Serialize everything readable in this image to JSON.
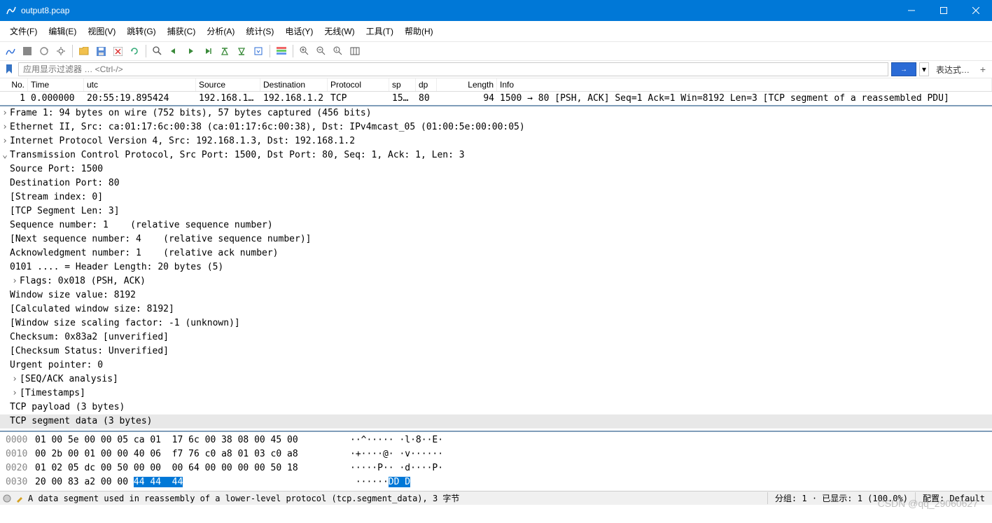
{
  "window": {
    "title": "output8.pcap"
  },
  "menu": {
    "file": "文件(F)",
    "edit": "编辑(E)",
    "view": "视图(V)",
    "go": "跳转(G)",
    "capture": "捕获(C)",
    "analyze": "分析(A)",
    "stats": "统计(S)",
    "telephony": "电话(Y)",
    "wireless": "无线(W)",
    "tools": "工具(T)",
    "help": "帮助(H)"
  },
  "filter": {
    "placeholder": "应用显示过滤器 … <Ctrl-/>",
    "expr_label": "表达式…"
  },
  "columns": {
    "no": "No.",
    "time": "Time",
    "utc": "utc",
    "src": "Source",
    "dst": "Destination",
    "proto": "Protocol",
    "sp": "sp",
    "dp": "dp",
    "len": "Length",
    "info": "Info"
  },
  "packet": {
    "no": "1",
    "time": "0.000000",
    "utc": "20:55:19.895424",
    "src": "192.168.1…",
    "dst": "192.168.1.2",
    "proto": "TCP",
    "sp": "15…",
    "dp": "80",
    "len": "94",
    "info": "1500 → 80 [PSH, ACK] Seq=1 Ack=1 Win=8192 Len=3 [TCP segment of a reassembled PDU]"
  },
  "details": {
    "frame": "Frame 1: 94 bytes on wire (752 bits), 57 bytes captured (456 bits)",
    "eth": "Ethernet II, Src: ca:01:17:6c:00:38 (ca:01:17:6c:00:38), Dst: IPv4mcast_05 (01:00:5e:00:00:05)",
    "ip": "Internet Protocol Version 4, Src: 192.168.1.3, Dst: 192.168.1.2",
    "tcp": "Transmission Control Protocol, Src Port: 1500, Dst Port: 80, Seq: 1, Ack: 1, Len: 3",
    "src_port": "Source Port: 1500",
    "dst_port": "Destination Port: 80",
    "stream": "[Stream index: 0]",
    "seglen": "[TCP Segment Len: 3]",
    "seq": "Sequence number: 1    (relative sequence number)",
    "nextseq": "[Next sequence number: 4    (relative sequence number)]",
    "ack": "Acknowledgment number: 1    (relative ack number)",
    "hdrlen": "0101 .... = Header Length: 20 bytes (5)",
    "flags": "Flags: 0x018 (PSH, ACK)",
    "win": "Window size value: 8192",
    "calcwin": "[Calculated window size: 8192]",
    "scale": "[Window size scaling factor: -1 (unknown)]",
    "cksum": "Checksum: 0x83a2 [unverified]",
    "ckstat": "[Checksum Status: Unverified]",
    "urg": "Urgent pointer: 0",
    "seqack": "[SEQ/ACK analysis]",
    "ts": "[Timestamps]",
    "payload": "TCP payload (3 bytes)",
    "segdata": "TCP segment data (3 bytes)"
  },
  "hex": {
    "rows": [
      {
        "off": "0000",
        "b": "01 00 5e 00 00 05 ca 01  17 6c 00 38 08 00 45 00",
        "a": "··^····· ·l·8··E·"
      },
      {
        "off": "0010",
        "b": "00 2b 00 01 00 00 40 06  f7 76 c0 a8 01 03 c0 a8",
        "a": "·+····@· ·v······"
      },
      {
        "off": "0020",
        "b": "01 02 05 dc 00 50 00 00  00 64 00 00 00 00 50 18",
        "a": "·····P·· ·d····P·"
      }
    ],
    "last": {
      "off": "0030",
      "pre": "20 00 83 a2 00 00 ",
      "sel": "44 44  44",
      "apre": " ······",
      "asel": "DD D"
    }
  },
  "status": {
    "left": "A data segment used in reassembly of a lower-level protocol (tcp.segment_data), 3 字节",
    "mid": "分组: 1 · 已显示: 1 (100.0%)",
    "right": "配置: Default"
  },
  "watermark": "CSDN @qq_29060627"
}
